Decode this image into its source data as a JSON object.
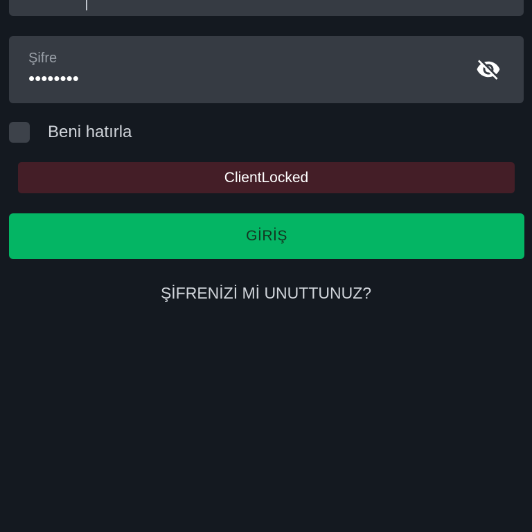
{
  "password_field": {
    "label": "Şifre",
    "value": "••••••••",
    "toggle_icon": "eye-off-icon"
  },
  "remember": {
    "label": "Beni hatırla",
    "checked": false
  },
  "error": {
    "message": "ClientLocked"
  },
  "login_button": {
    "label": "GİRİŞ"
  },
  "forgot_link": {
    "label": "ŞİFRENİZİ Mİ UNUTTUNUZ?"
  },
  "colors": {
    "background": "#141920",
    "field": "#363b43",
    "error_bg": "#441e27",
    "accent_green": "#04b564"
  }
}
